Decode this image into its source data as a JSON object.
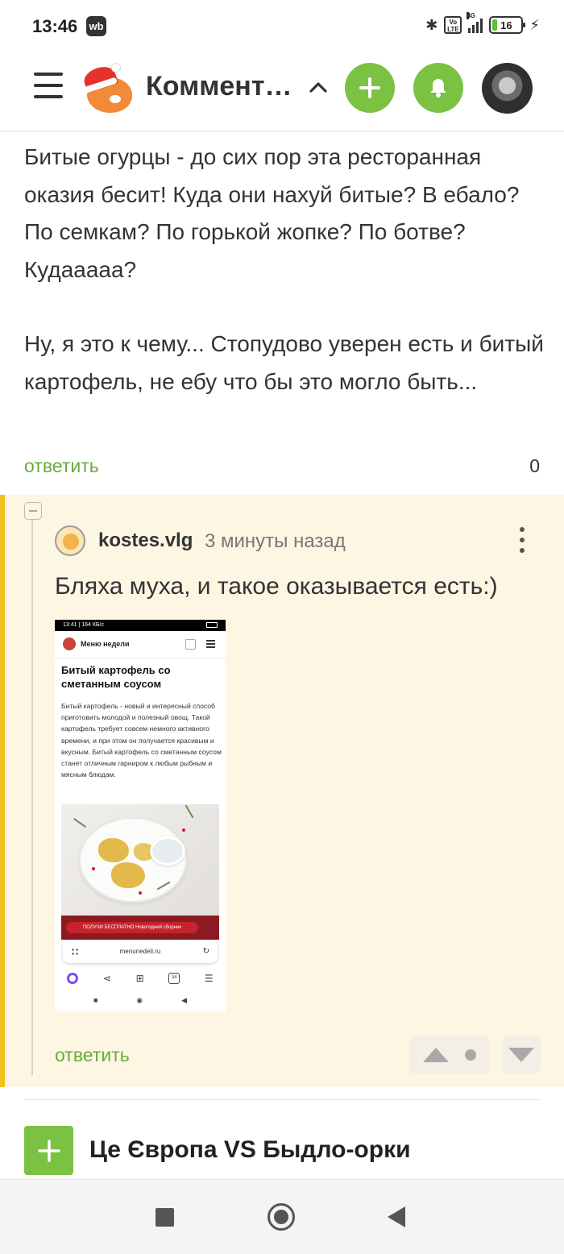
{
  "status_bar": {
    "time": "13:46",
    "wb_badge": "wb",
    "network": "4G",
    "volte": "Vo LTE",
    "battery_percent": "16",
    "battery_level": 0.16
  },
  "header": {
    "title": "Коммент…",
    "accent_color": "#7bc142"
  },
  "comment1": {
    "paragraphs": [
      "Битые огурцы - до сих пор эта ресторанная оказия бесит! Куда они нахуй битые? В ебало? По семкам? По горькой жопке? По ботве? Кудааааа?",
      "Ну, я это к чему... Стопудово уверен есть и битый картофель, не ебу что бы это могло быть..."
    ],
    "reply_label": "ответить",
    "rating": "0"
  },
  "comment2": {
    "username": "kostes.vlg",
    "time_ago": "3 минуты назад",
    "text": "Бляха муха, и такое оказывается есть:)",
    "reply_label": "ответить",
    "highlight_color": "#fdf6e3",
    "bar_color": "#f2c21e",
    "attachment": {
      "status_text": "13:41 | 164 КБ/с",
      "site_title": "Меню недели",
      "heading": "Битый картофель со сметанным соусом",
      "body": "Битый картофель - новый и интересный способ приготовить молодой и полезный овощ. Такой картофель требует совсем немного активного времени, и при этом он получается красивым и вкусным. Битый картофель со сметанным соусом станет отличным гарниром к любым рыбным и мясным блюдам.",
      "promo": "ПОЛУЧИ БЕСПЛАТНО Новогодний сборник",
      "url": "menunedeli.ru",
      "tabs_count": "34"
    }
  },
  "next_post": {
    "title": "Це Європа VS Быдло-орки"
  }
}
